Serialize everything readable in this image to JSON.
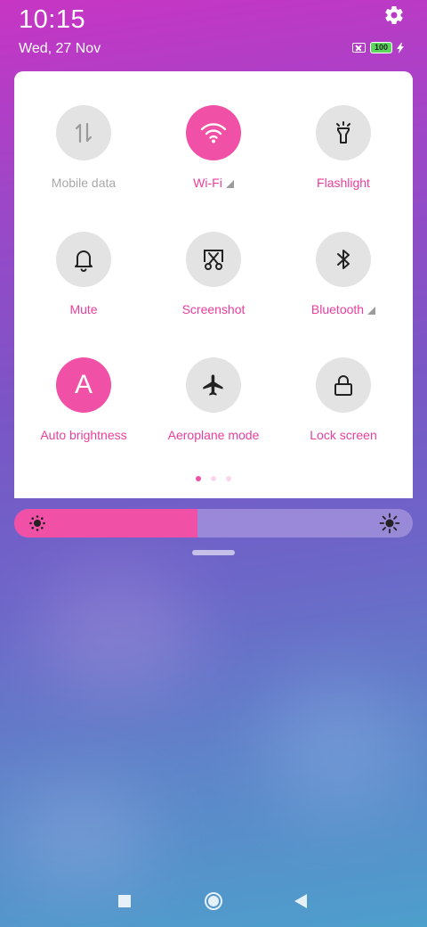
{
  "status": {
    "time": "10:15",
    "date": "Wed, 27 Nov",
    "battery": "100",
    "icons": [
      "gear-icon",
      "no-sim-icon",
      "battery-icon",
      "charging-bolt-icon"
    ]
  },
  "tiles": [
    {
      "label": "Mobile data",
      "icon": "mobile-data-arrows-icon",
      "active": false,
      "dim": true,
      "has_menu": false
    },
    {
      "label": "Wi-Fi",
      "icon": "wifi-icon",
      "active": true,
      "dim": false,
      "has_menu": true
    },
    {
      "label": "Flashlight",
      "icon": "flashlight-icon",
      "active": false,
      "dim": false,
      "has_menu": false
    },
    {
      "label": "Mute",
      "icon": "bell-icon",
      "active": false,
      "dim": false,
      "has_menu": false
    },
    {
      "label": "Screenshot",
      "icon": "scissors-screenshot-icon",
      "active": false,
      "dim": false,
      "has_menu": false
    },
    {
      "label": "Bluetooth",
      "icon": "bluetooth-icon",
      "active": false,
      "dim": false,
      "has_menu": true
    },
    {
      "label": "Auto brightness",
      "icon": "auto-brightness-A-icon",
      "glyph": "A",
      "active": true,
      "dim": false,
      "has_menu": false
    },
    {
      "label": "Aeroplane mode",
      "icon": "airplane-icon",
      "active": false,
      "dim": false,
      "has_menu": false
    },
    {
      "label": "Lock screen",
      "icon": "lock-icon",
      "active": false,
      "dim": false,
      "has_menu": false
    }
  ],
  "pager": {
    "count": 3,
    "active": 0
  },
  "brightness": {
    "level": 0.46,
    "low_icon": "sun-low-icon",
    "high_icon": "sun-high-icon"
  },
  "nav": [
    "recents-square-icon",
    "home-circle-icon",
    "back-triangle-icon"
  ],
  "colors": {
    "accent": "#f050a6",
    "tile_off": "#e3e3e3",
    "label_dim": "#a8a8a8"
  }
}
